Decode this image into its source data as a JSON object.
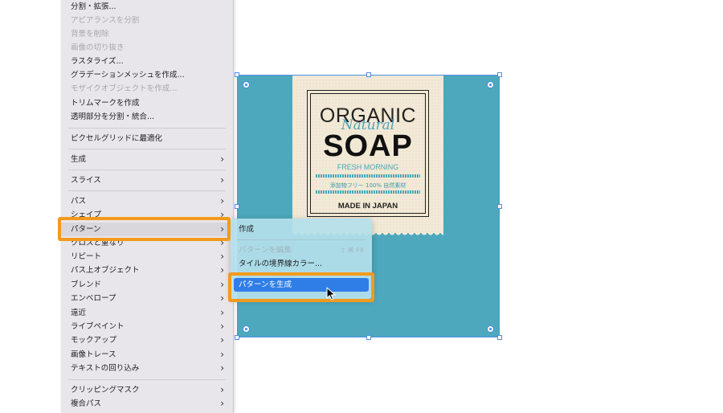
{
  "object_menu": {
    "items": [
      {
        "label": "分割・拡張...",
        "disabled": false
      },
      {
        "label": "アピアランスを分割",
        "disabled": true
      },
      {
        "label": "背景を削除",
        "disabled": true
      },
      {
        "label": "画像の切り抜き",
        "disabled": true
      },
      {
        "label": "ラスタライズ...",
        "disabled": false
      },
      {
        "label": "グラデーションメッシュを作成...",
        "disabled": false
      },
      {
        "label": "モザイクオブジェクトを作成...",
        "disabled": true
      },
      {
        "label": "トリムマークを作成",
        "disabled": false
      },
      {
        "label": "透明部分を分割・統合...",
        "disabled": false
      },
      {
        "label": "ピクセルグリッドに最適化",
        "disabled": false
      },
      {
        "label": "生成",
        "submenu": true
      },
      {
        "label": "スライス",
        "submenu": true
      },
      {
        "label": "パス",
        "submenu": true
      },
      {
        "label": "シェイプ",
        "submenu": true
      },
      {
        "label": "パターン",
        "submenu": true
      },
      {
        "label": "クロスと重なり",
        "submenu": true
      },
      {
        "label": "リピート",
        "submenu": true
      },
      {
        "label": "パス上オブジェクト",
        "submenu": true
      },
      {
        "label": "ブレンド",
        "submenu": true
      },
      {
        "label": "エンベロープ",
        "submenu": true
      },
      {
        "label": "遠近",
        "submenu": true
      },
      {
        "label": "ライブペイント",
        "submenu": true
      },
      {
        "label": "モックアップ",
        "submenu": true
      },
      {
        "label": "画像トレース",
        "submenu": true
      },
      {
        "label": "テキストの回り込み",
        "submenu": true
      },
      {
        "label": "クリッピングマスク",
        "submenu": true
      },
      {
        "label": "複合パス",
        "submenu": true
      }
    ],
    "arrow": "›"
  },
  "pattern_submenu": {
    "items": [
      {
        "label": "作成",
        "disabled": false
      },
      {
        "label": "パターンを編集",
        "disabled": true,
        "shortcut": "⇧ ⌘ F8"
      },
      {
        "label": "タイルの境界線カラー...",
        "disabled": false
      },
      {
        "label": "パターンを生成",
        "disabled": false,
        "active": true
      }
    ]
  },
  "artwork": {
    "line1": "ORGANIC",
    "line2": "Natural",
    "line3": "SOAP",
    "line4": "FRESH MORNING",
    "line5": "添加物フリー 100% 自然素材",
    "line6": "MADE IN JAPAN",
    "colors": {
      "background": "#4da8bd",
      "paper": "#f2e9d6",
      "accent": "#4ba5b8"
    }
  },
  "colors": {
    "highlight": "#f39a1c",
    "selection": "#4a90e2",
    "active_item": "#2f7ee8"
  }
}
